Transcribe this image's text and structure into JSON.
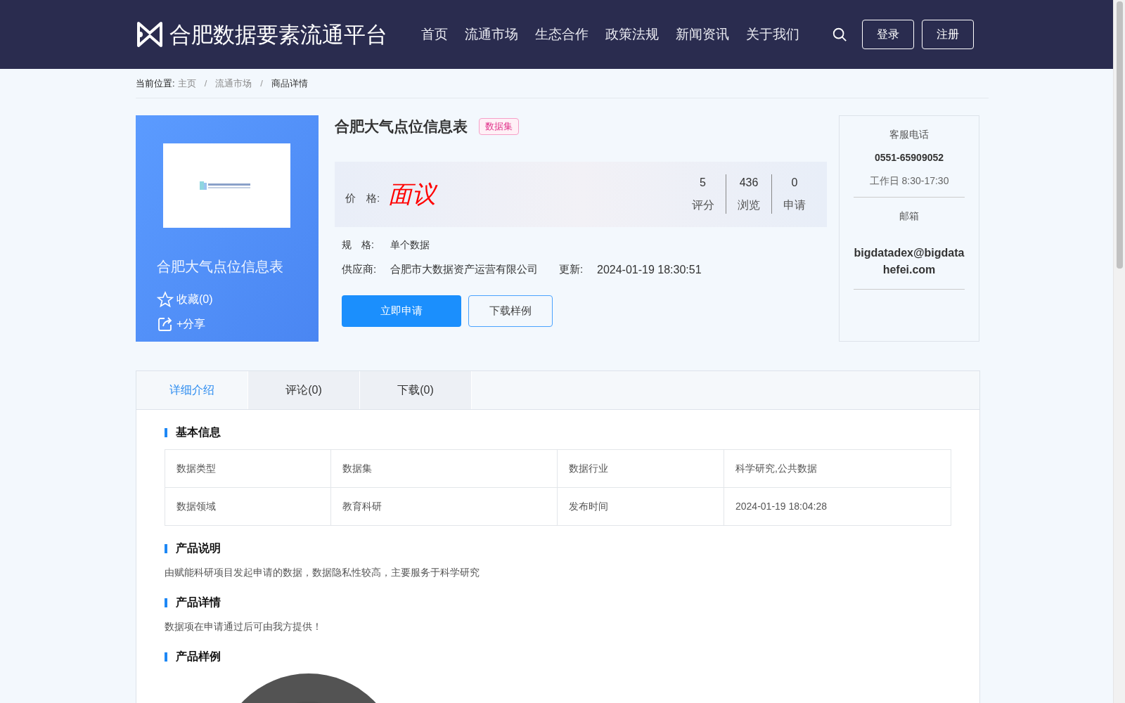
{
  "header": {
    "site_title": "合肥数据要素流通平台",
    "nav": [
      {
        "label": "首页",
        "selected": false
      },
      {
        "label": "流通市场",
        "selected": false
      },
      {
        "label": "生态合作",
        "selected": false
      },
      {
        "label": "政策法规",
        "selected": false
      },
      {
        "label": "新闻资讯",
        "selected": false
      },
      {
        "label": "关于我们",
        "selected": false
      }
    ],
    "buttons": [
      "登录",
      "注册"
    ]
  },
  "breadcrumb": {
    "label": "当前位置:",
    "separator": "/",
    "items": [
      "主页",
      "流通市场",
      "商品详情"
    ]
  },
  "product_card": {
    "name": "合肥大气点位信息表",
    "favorite": "收藏(0)",
    "share": "+分享"
  },
  "product": {
    "title": "合肥大气点位信息表",
    "tag": "数据集",
    "price_label": "价　格:",
    "price": "面议",
    "stats": [
      {
        "value": "5",
        "label": "评分"
      },
      {
        "value": "436",
        "label": "浏览"
      },
      {
        "value": "0",
        "label": "申请"
      }
    ],
    "spec_label": "规　格:",
    "spec": "单个数据",
    "supplier_label": "供应商:",
    "supplier": "合肥市大数据资产运营有限公司",
    "updated_label": "更新:",
    "updated": "2024-01-19 18:30:51",
    "apply_button": "立即申请",
    "download_button": "下载样例"
  },
  "contact": {
    "phone_label": "客服电话",
    "phone": "0551-65909052",
    "hours": "工作日 8:30-17:30",
    "email_label": "邮箱",
    "email": "bigdatadex@bigdatahefei.com"
  },
  "tabs": [
    {
      "label": "详细介绍",
      "selected": true
    },
    {
      "label": "评论(0)",
      "selected": false
    },
    {
      "label": "下载(0)",
      "selected": false
    }
  ],
  "basic_info": {
    "title": "基本信息",
    "rows": [
      [
        "数据类型",
        "数据集",
        "数据行业",
        "科学研究,公共数据"
      ],
      [
        "数据领域",
        "教育科研",
        "发布时间",
        "2024-01-19 18:04:28"
      ]
    ]
  },
  "description": {
    "title": "产品说明",
    "text": "由赋能科研项目发起申请的数据，数据隐私性较高，主要服务于科学研究"
  },
  "details": {
    "title": "产品详情",
    "text": "数据项在申请通过后可由我方提供！"
  },
  "sample": {
    "title": "产品样例"
  }
}
